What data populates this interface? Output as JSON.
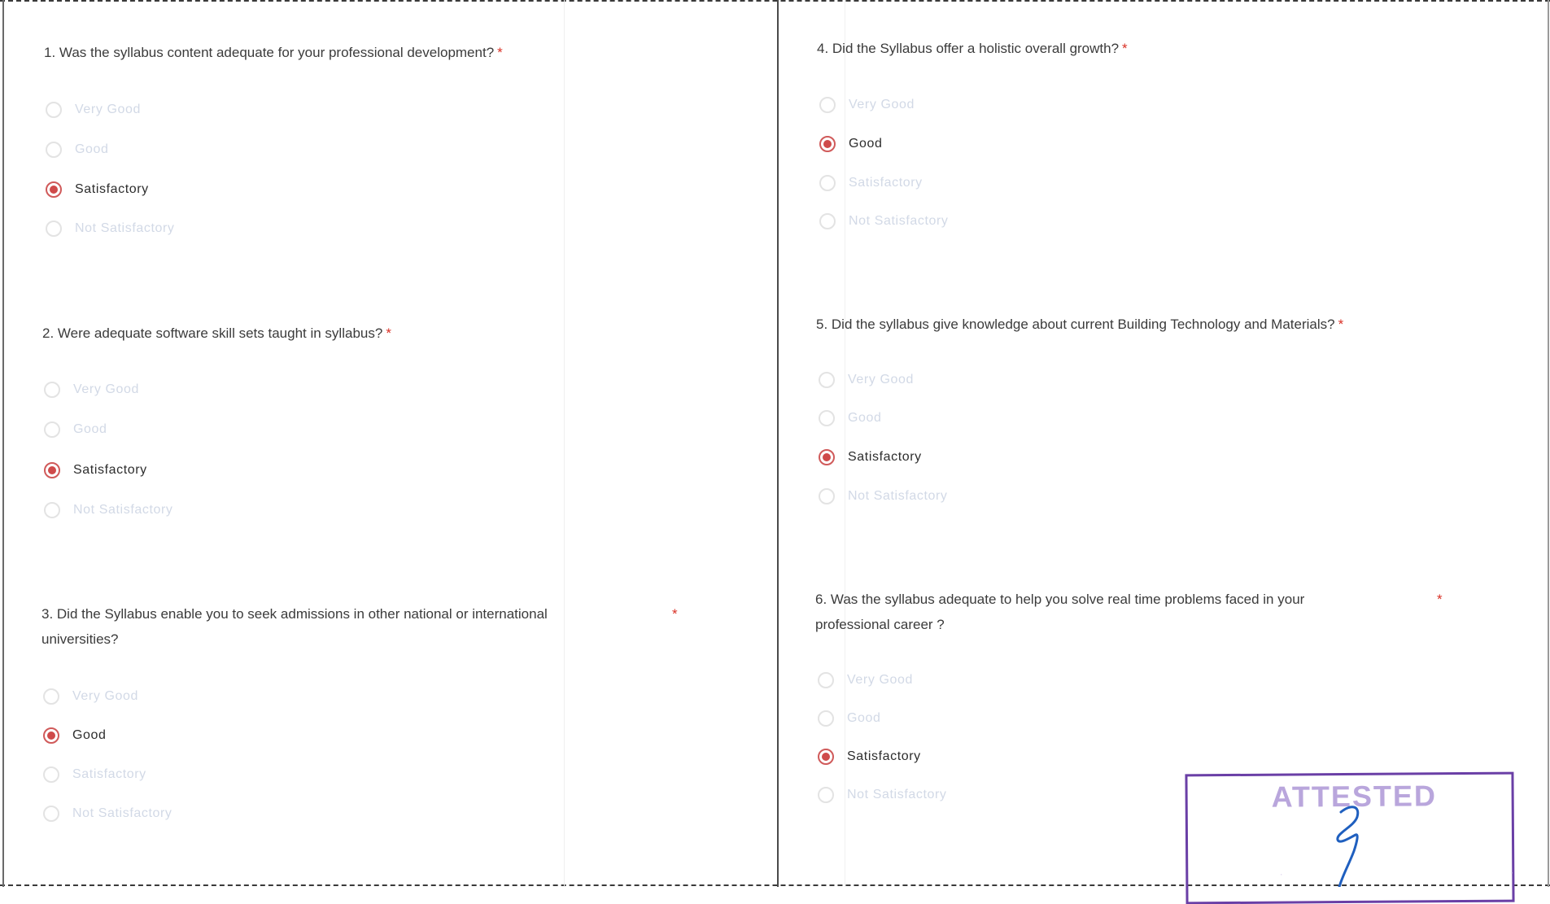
{
  "form": {
    "required_marker": "*",
    "questions": [
      {
        "text": "1. Was the syllabus content adequate for your professional development?",
        "options": [
          {
            "label": "Very Good",
            "checked": false
          },
          {
            "label": "Good",
            "checked": false
          },
          {
            "label": "Satisfactory",
            "checked": true
          },
          {
            "label": "Not Satisfactory",
            "checked": false
          }
        ]
      },
      {
        "text": "2. Were adequate software skill sets taught in syllabus?",
        "options": [
          {
            "label": "Very Good",
            "checked": false
          },
          {
            "label": "Good",
            "checked": false
          },
          {
            "label": "Satisfactory",
            "checked": true
          },
          {
            "label": "Not Satisfactory",
            "checked": false
          }
        ]
      },
      {
        "text_line1": "3. Did the Syllabus enable you to seek admissions in other national or international",
        "text_line2": "universities?",
        "options": [
          {
            "label": "Very Good",
            "checked": false
          },
          {
            "label": "Good",
            "checked": true
          },
          {
            "label": "Satisfactory",
            "checked": false
          },
          {
            "label": "Not Satisfactory",
            "checked": false
          }
        ]
      },
      {
        "text": "4. Did the Syllabus offer a holistic overall growth?",
        "options": [
          {
            "label": "Very Good",
            "checked": false
          },
          {
            "label": "Good",
            "checked": true
          },
          {
            "label": "Satisfactory",
            "checked": false
          },
          {
            "label": "Not Satisfactory",
            "checked": false
          }
        ]
      },
      {
        "text": "5. Did the syllabus give knowledge about current Building Technology and Materials?",
        "options": [
          {
            "label": "Very Good",
            "checked": false
          },
          {
            "label": "Good",
            "checked": false
          },
          {
            "label": "Satisfactory",
            "checked": true
          },
          {
            "label": "Not Satisfactory",
            "checked": false
          }
        ]
      },
      {
        "text_line1": "6. Was the syllabus adequate to help you solve real time problems faced in your",
        "text_line2": "professional career ?",
        "options": [
          {
            "label": "Very Good",
            "checked": false
          },
          {
            "label": "Good",
            "checked": false
          },
          {
            "label": "Satisfactory",
            "checked": true
          },
          {
            "label": "Not Satisfactory",
            "checked": false
          }
        ]
      }
    ]
  },
  "stamp": {
    "text": "ATTESTED",
    "color": "#6a3fa6"
  },
  "colors": {
    "selected_radio": "#cf4a4a",
    "required_marker": "#d93025",
    "signature_ink": "#1f5fbf"
  }
}
